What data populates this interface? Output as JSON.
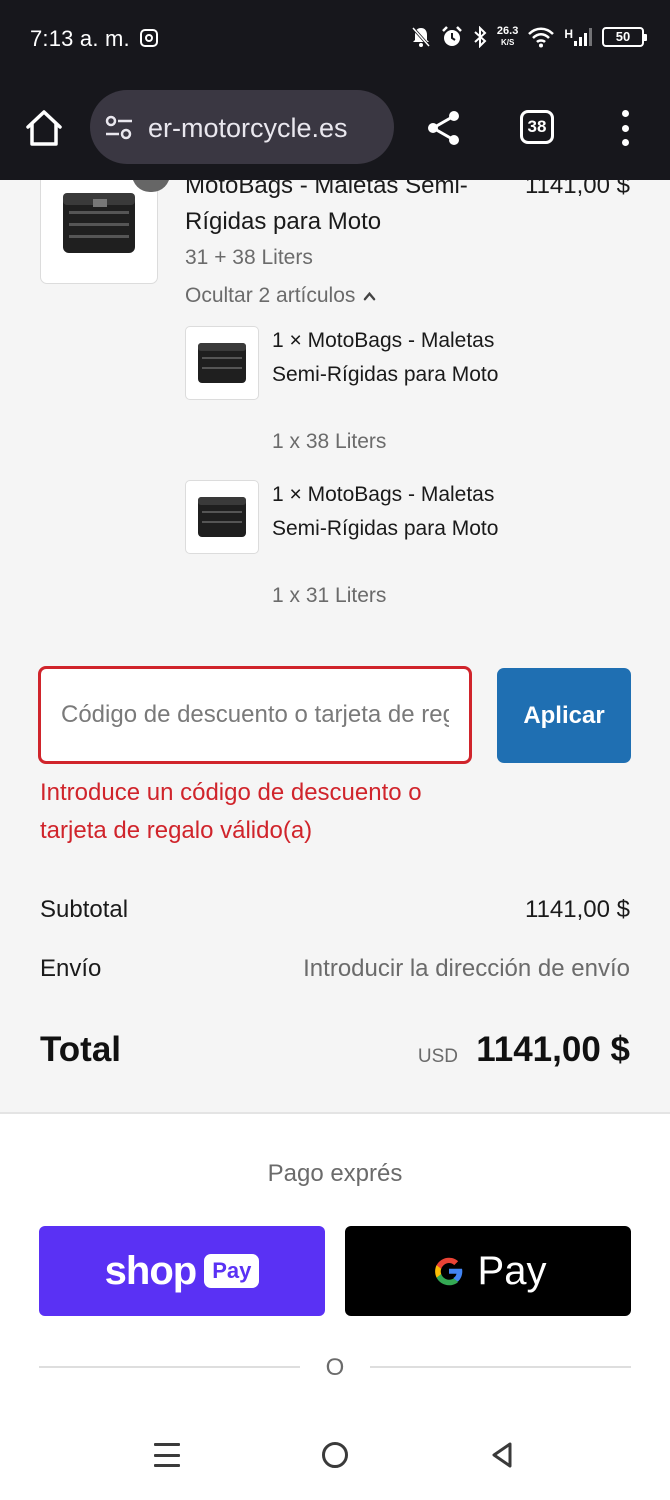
{
  "status_bar": {
    "time": "7:13 a. m.",
    "net_speed_value": "26.3",
    "net_speed_unit": "K/S",
    "network_type": "H",
    "battery": "50",
    "icons": [
      "instagram-icon",
      "bell-off-icon",
      "alarm-icon",
      "bluetooth-icon",
      "wifi-icon",
      "signal-icon",
      "battery-icon"
    ]
  },
  "browser": {
    "url": "er-motorcycle.es",
    "tab_count": "38",
    "icons": [
      "home-icon",
      "site-settings-icon",
      "share-icon",
      "tabs-icon",
      "more-vert-icon"
    ]
  },
  "order": {
    "product": {
      "title": "MotoBags - Maletas Semi-Rígidas para Moto",
      "price": "1141,00 $",
      "variant": "31 + 38 Liters"
    },
    "toggle_label": "Ocultar 2 artículos",
    "sub_items": [
      {
        "name": "1 × MotoBags - Maletas Semi-Rígidas para Moto",
        "variant": "1 x 38 Liters"
      },
      {
        "name": "1 × MotoBags - Maletas Semi-Rígidas para Moto",
        "variant": "1 x 31 Liters"
      }
    ]
  },
  "discount": {
    "placeholder": "Código de descuento o tarjeta de regalo",
    "apply_label": "Aplicar",
    "error": "Introduce un código de descuento o tarjeta de regalo válido(a)"
  },
  "summary": {
    "subtotal_label": "Subtotal",
    "subtotal_value": "1141,00 $",
    "shipping_label": "Envío",
    "shipping_value": "Introducir la dirección de envío",
    "total_label": "Total",
    "currency": "USD",
    "total_value": "1141,00 $"
  },
  "express": {
    "title": "Pago exprés",
    "shop_word": "shop",
    "shop_pay_badge": "Pay",
    "gpay_word": "Pay",
    "divider": "O"
  },
  "colors": {
    "accent": "#1f6fb2",
    "error": "#d0242b",
    "shop_pay": "#5a31f4",
    "status_bar": "#17171c"
  }
}
